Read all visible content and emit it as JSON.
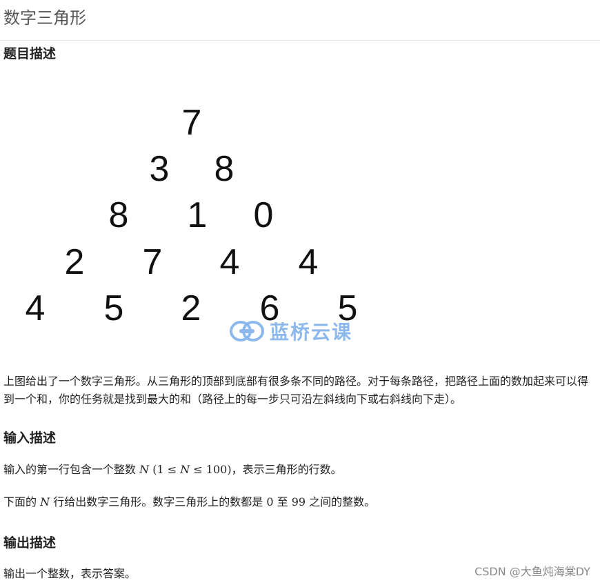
{
  "page": {
    "title": "数字三角形"
  },
  "sections": {
    "description_heading": "题目描述",
    "input_heading": "输入描述",
    "output_heading": "输出描述"
  },
  "triangle": {
    "rows": [
      [
        "7"
      ],
      [
        "3",
        "8"
      ],
      [
        "8",
        "1",
        "0"
      ],
      [
        "2",
        "7",
        "4",
        "4"
      ],
      [
        "4",
        "5",
        "2",
        "6",
        "5"
      ]
    ]
  },
  "watermark": {
    "text": "蓝桥云课",
    "color": "#2f7fe0"
  },
  "description": {
    "paragraph": "上图给出了一个数字三角形。从三角形的顶部到底部有很多条不同的路径。对于每条路径，把路径上面的数加起来可以得到一个和，你的任务就是找到最大的和（路径上的每一步只可沿左斜线向下或右斜线向下走）。"
  },
  "input": {
    "line1_before": "输入的第一行包含一个整数",
    "line1_var": "N",
    "line1_math_open": "(1 ≤ ",
    "line1_math_var": "N",
    "line1_math_close": " ≤ 100)",
    "line1_after": "，表示三角形的行数。",
    "line2_before": "下面的",
    "line2_var": "N",
    "line2_middle": "行给出数字三角形。数字三角形上的数都是",
    "line2_low": "0",
    "line2_to": "至",
    "line2_high": "99",
    "line2_after": "之间的整数。"
  },
  "output": {
    "line1": "输出一个整数，表示答案。"
  },
  "credit": {
    "text": "CSDN @大鱼炖海棠DY"
  }
}
